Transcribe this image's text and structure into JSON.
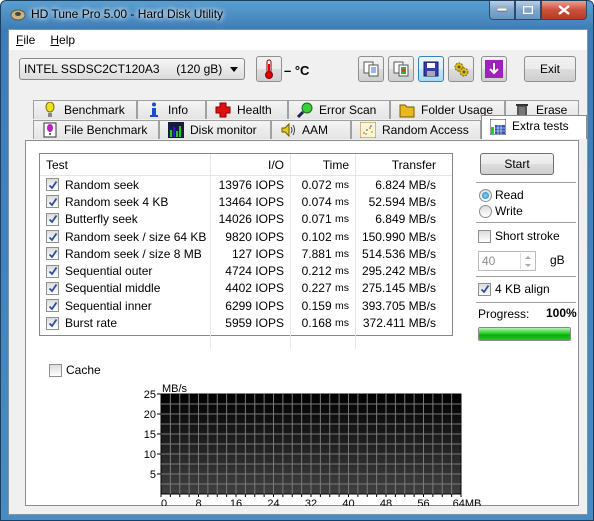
{
  "window": {
    "title": "HD Tune Pro 5.00 - Hard Disk Utility",
    "controls": [
      "minimize",
      "maximize",
      "close"
    ]
  },
  "menu": [
    {
      "label": "File",
      "accel": "F"
    },
    {
      "label": "Help",
      "accel": "H"
    }
  ],
  "toolbar": {
    "drive": "INTEL SSDSC2CT120A3     (120 gB)",
    "temperature": "– °C",
    "icons": [
      "thermometer-icon",
      "copy-text-icon",
      "copy-screenshot-icon",
      "save-icon",
      "options-icon",
      "download-icon"
    ],
    "exit_label": "Exit"
  },
  "tabs": {
    "row1": [
      {
        "label": "Benchmark",
        "icon": "benchmark-icon"
      },
      {
        "label": "Info",
        "icon": "info-icon"
      },
      {
        "label": "Health",
        "icon": "health-icon"
      },
      {
        "label": "Error Scan",
        "icon": "error-scan-icon"
      },
      {
        "label": "Folder Usage",
        "icon": "folder-icon"
      },
      {
        "label": "Erase",
        "icon": "trash-icon"
      }
    ],
    "row2": [
      {
        "label": "File Benchmark",
        "icon": "file-benchmark-icon"
      },
      {
        "label": "Disk monitor",
        "icon": "disk-monitor-icon"
      },
      {
        "label": "AAM",
        "icon": "speaker-icon"
      },
      {
        "label": "Random Access",
        "icon": "random-access-icon"
      },
      {
        "label": "Extra tests",
        "icon": "extra-tests-icon",
        "selected": true
      }
    ]
  },
  "table": {
    "columns": [
      "Test",
      "I/O",
      "Time",
      "Transfer"
    ],
    "rows": [
      {
        "checked": true,
        "test": "Random seek",
        "io": "13976 IOPS",
        "time": "0.072",
        "time_unit": "ms",
        "transfer": "6.824 MB/s"
      },
      {
        "checked": true,
        "test": "Random seek 4 KB",
        "io": "13464 IOPS",
        "time": "0.074",
        "time_unit": "ms",
        "transfer": "52.594 MB/s"
      },
      {
        "checked": true,
        "test": "Butterfly seek",
        "io": "14026 IOPS",
        "time": "0.071",
        "time_unit": "ms",
        "transfer": "6.849 MB/s"
      },
      {
        "checked": true,
        "test": "Random seek / size 64 KB",
        "io": "9820 IOPS",
        "time": "0.102",
        "time_unit": "ms",
        "transfer": "150.990 MB/s"
      },
      {
        "checked": true,
        "test": "Random seek / size 8 MB",
        "io": "127 IOPS",
        "time": "7.881",
        "time_unit": "ms",
        "transfer": "514.536 MB/s"
      },
      {
        "checked": true,
        "test": "Sequential outer",
        "io": "4724 IOPS",
        "time": "0.212",
        "time_unit": "ms",
        "transfer": "295.242 MB/s"
      },
      {
        "checked": true,
        "test": "Sequential middle",
        "io": "4402 IOPS",
        "time": "0.227",
        "time_unit": "ms",
        "transfer": "275.145 MB/s"
      },
      {
        "checked": true,
        "test": "Sequential inner",
        "io": "6299 IOPS",
        "time": "0.159",
        "time_unit": "ms",
        "transfer": "393.705 MB/s"
      },
      {
        "checked": true,
        "test": "Burst rate",
        "io": "5959 IOPS",
        "time": "0.168",
        "time_unit": "ms",
        "transfer": "372.411 MB/s"
      }
    ]
  },
  "side": {
    "start_label": "Start",
    "mode": {
      "options": [
        "Read",
        "Write"
      ],
      "selected": "Read"
    },
    "short_stroke": {
      "label": "Short stroke",
      "checked": false,
      "value": "40",
      "unit": "gB"
    },
    "align": {
      "label": "4 KB align",
      "checked": true
    },
    "progress": {
      "label": "Progress:",
      "value_text": "100%",
      "percent": 100
    }
  },
  "cache": {
    "label": "Cache",
    "checked": false
  },
  "chart_data": {
    "type": "line",
    "title": "",
    "ylabel": "MB/s",
    "xlabel": "MB",
    "ylim": [
      0,
      25
    ],
    "xlim": [
      0,
      64
    ],
    "yticks": [
      5,
      10,
      15,
      20,
      25
    ],
    "xticks": [
      "0",
      "8",
      "16",
      "24",
      "32",
      "40",
      "48",
      "56",
      "64MB"
    ],
    "grid": true,
    "series": []
  }
}
